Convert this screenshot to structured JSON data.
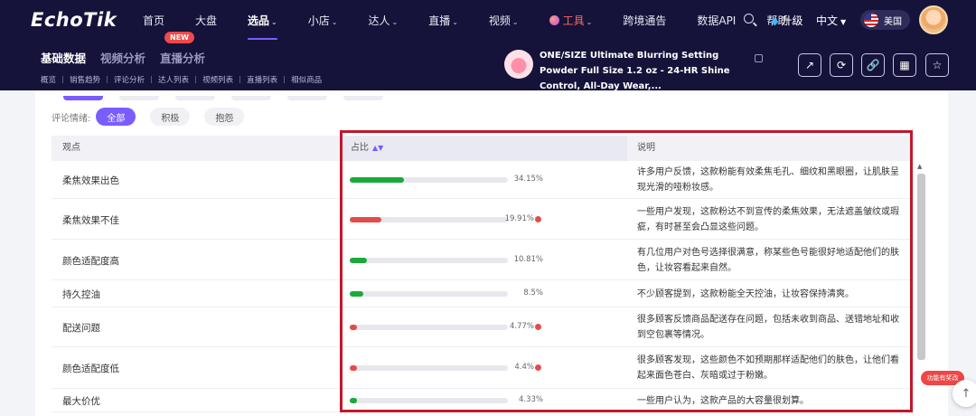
{
  "app": {
    "logo": "EchoTik"
  },
  "nav": {
    "items": [
      {
        "label": "首页",
        "chev": ""
      },
      {
        "label": "大盘",
        "chev": ""
      },
      {
        "label": "选品",
        "chev": "⌄"
      },
      {
        "label": "小店",
        "chev": "⌄"
      },
      {
        "label": "达人",
        "chev": "⌄"
      },
      {
        "label": "直播",
        "chev": "⌄"
      },
      {
        "label": "视频",
        "chev": "⌄"
      },
      {
        "label": "工具",
        "chev": "⌄"
      },
      {
        "label": "跨境通告",
        "chev": ""
      },
      {
        "label": "数据API",
        "chev": ""
      },
      {
        "label": "帮助",
        "chev": "⌄"
      }
    ],
    "active_index": 2,
    "upgrade_label": "升级",
    "language": "中文",
    "region": "美国"
  },
  "subnav": {
    "tabs": [
      "基础数据",
      "视频分析",
      "直播分析"
    ],
    "links": [
      "概览",
      "销售趋势",
      "评论分析",
      "达人列表",
      "视频列表",
      "直播列表",
      "相似商品"
    ],
    "new_badge": "NEW"
  },
  "product": {
    "title": "ONE/SIZE Ultimate Blurring Setting Powder Full Size 1.2 oz - 24-HR Shine Control, All-Day Wear,..."
  },
  "actions": [
    {
      "name": "share-icon",
      "glyph": "↗"
    },
    {
      "name": "refresh-icon",
      "glyph": "⟳"
    },
    {
      "name": "link-icon",
      "glyph": "🔗"
    },
    {
      "name": "qrcode-icon",
      "glyph": "▦"
    },
    {
      "name": "star-icon",
      "glyph": "☆"
    }
  ],
  "filter": {
    "label": "评论情绪:",
    "options": [
      "全部",
      "积极",
      "抱怨"
    ],
    "selected": "全部"
  },
  "table": {
    "headers": {
      "viewpoint": "观点",
      "ratio": "占比",
      "description": "说明"
    },
    "rows": [
      {
        "viewpoint": "柔焦效果出色",
        "ratio": 34.15,
        "ratio_label": "34.15%",
        "sentiment": "positive",
        "description": "许多用户反馈，这款粉能有效柔焦毛孔、细纹和黑眼圈，让肌肤呈现光滑的哑粉妆感。"
      },
      {
        "viewpoint": "柔焦效果不佳",
        "ratio": 19.91,
        "ratio_label": "19.91%",
        "sentiment": "negative",
        "description": "一些用户发现，这款粉达不到宣传的柔焦效果，无法遮盖皱纹或瑕疵，有时甚至会凸显这些问题。"
      },
      {
        "viewpoint": "颜色适配度高",
        "ratio": 10.81,
        "ratio_label": "10.81%",
        "sentiment": "positive",
        "description": "有几位用户对色号选择很满意，称某些色号能很好地适配他们的肤色，让妆容看起来自然。"
      },
      {
        "viewpoint": "持久控油",
        "ratio": 8.5,
        "ratio_label": "8.5%",
        "sentiment": "positive",
        "description": "不少顾客提到，这款粉能全天控油，让妆容保持清爽。"
      },
      {
        "viewpoint": "配送问题",
        "ratio": 4.77,
        "ratio_label": "4.77%",
        "sentiment": "negative",
        "description": "很多顾客反馈商品配送存在问题，包括未收到商品、送错地址和收到空包裹等情况。"
      },
      {
        "viewpoint": "颜色适配度低",
        "ratio": 4.4,
        "ratio_label": "4.4%",
        "sentiment": "negative",
        "description": "很多顾客发现，这些颜色不如预期那样适配他们的肤色，让他们看起来面色苍白、灰暗或过于粉嫩。"
      },
      {
        "viewpoint": "最大价优",
        "ratio": 4.33,
        "ratio_label": "4.33%",
        "sentiment": "positive",
        "description": "一些用户认为，这款产品的大容量很划算。"
      }
    ]
  },
  "colors": {
    "positive": "#1aaa3a",
    "negative": "#e54b4b",
    "accent": "#7b5cff",
    "highlight": "#c3162c"
  },
  "float": {
    "label": "功能有奖改"
  }
}
